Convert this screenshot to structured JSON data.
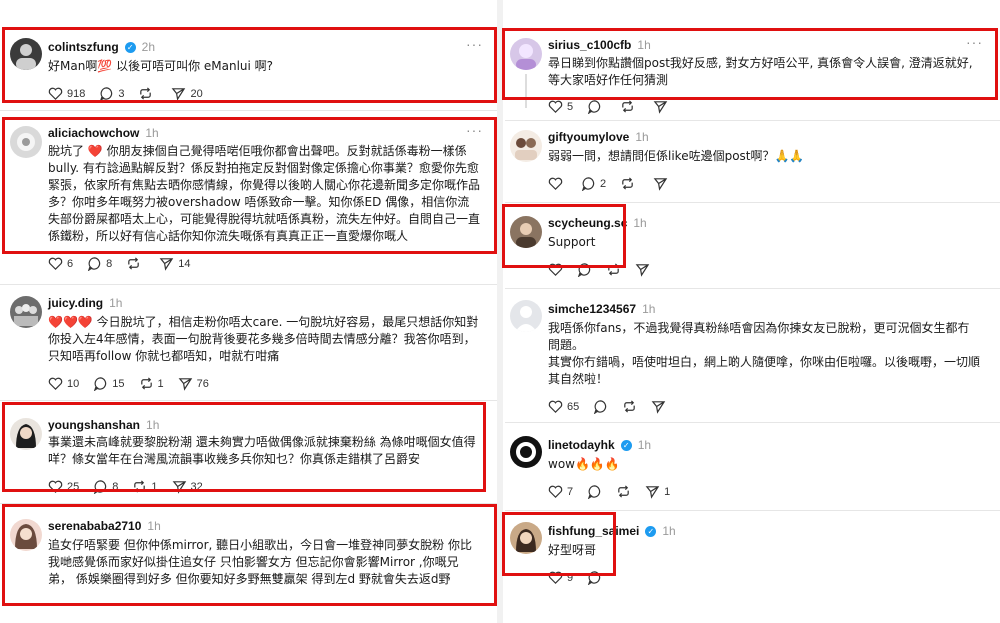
{
  "left": [
    {
      "username": "colintszfung",
      "verified": true,
      "time": "2h",
      "text": "好Man啊💯 以後可唔可叫你 eManlui 啊?",
      "likes": "918",
      "comments": "3",
      "reposts": "",
      "shares": "20"
    },
    {
      "username": "aliciachowchow",
      "verified": false,
      "time": "1h",
      "text": "脫坑了 ❤️ 你朋友揀個自己覺得唔啱佢哦你都會出聲吧。反對就話係毒粉一樣係bully. 有冇諗過點解反對？係反對拍拖定反對個對像定係擔心你事業？愈愛你先愈緊張，依家所有焦點去晒你感情線，你覺得以後啲人關心你花邊新聞多定你嘅作品多？你咁多年嘅努力被overshadow 唔係致命一擊。知你係ED 偶像，相信你流失部份爵屎都唔太上心，可能覺得脫得坑就唔係真粉，流失左仲好。自問自己一直係鐵粉，所以好有信心話你知你流失嘅係有真真正正一直愛爆你嘅人",
      "likes": "6",
      "comments": "8",
      "reposts": "",
      "shares": "14"
    },
    {
      "username": "juicy.ding",
      "verified": false,
      "time": "1h",
      "text": "❤️❤️❤️ 今日脫坑了，相信走粉你唔太care. 一句脫坑好容易，最尾只想話你知對你投入左4年感情，表面一句脫背後要花多幾多倍時間去情感分離？我答你唔到，只知唔再follow 你就乜都唔知，咁就冇咁痛",
      "likes": "10",
      "comments": "15",
      "reposts": "1",
      "shares": "76"
    },
    {
      "username": "youngshanshan",
      "verified": false,
      "time": "1h",
      "text": "事業還未高峰就要黎脫粉潮 還未夠實力唔做偶像派就揀棄粉絲 為條咁嘅個女值得咩？條女當年在台灣風流韻事收幾多兵你知乜？你真係走錯棋了呂爵安",
      "likes": "25",
      "comments": "8",
      "reposts": "1",
      "shares": "32"
    },
    {
      "username": "serenababa2710",
      "verified": false,
      "time": "1h",
      "text": "追女仔唔緊要 但你仲係mirror, 聽日小組歌出，今日會一堆登神同夢女脫粉 你比我哋感覺係而家好似掛住追女仔 只怕影響女方 但忘記你會影響Mirror ,你嘅兄弟， 係娛樂圈得到好多 但你要知好多野無雙贏架 得到左d 野就會失去返d野",
      "likes": "",
      "comments": "",
      "reposts": "",
      "shares": ""
    }
  ],
  "right": [
    {
      "username": "sirius_c100cfb",
      "verified": false,
      "time": "1h",
      "text": "尋日睇到你點讚個post我好反感, 對女方好唔公平, 真係會令人誤會, 澄清返就好, 等大家唔好作任何猜測",
      "likes": "5",
      "comments": "",
      "reposts": "",
      "shares": ""
    },
    {
      "username": "giftyoumylove",
      "verified": false,
      "time": "1h",
      "text": "弱弱一問，想請問佢係like咗邊個post啊？🙏🙏",
      "likes": "",
      "comments": "2",
      "reposts": "",
      "shares": ""
    },
    {
      "username": "scycheung.sc",
      "verified": false,
      "time": "1h",
      "text": "Support",
      "likes": "",
      "comments": "",
      "reposts": "",
      "shares": ""
    },
    {
      "username": "simche1234567",
      "verified": false,
      "time": "1h",
      "text": "我唔係你fans，不過我覺得真粉絲唔會因為你揀女友已脫粉，更可況個女生都冇問題。\n其實你冇錯喎，唔使咁坦白，網上啲人隨便嗱，你咪由佢啦囉。以後嘅嘢，一切順其自然啦！",
      "likes": "65",
      "comments": "",
      "reposts": "",
      "shares": ""
    },
    {
      "username": "linetodayhk",
      "verified": true,
      "time": "1h",
      "text": "wow🔥🔥🔥",
      "likes": "7",
      "comments": "",
      "reposts": "",
      "shares": "1"
    },
    {
      "username": "fishfung_saimei",
      "verified": true,
      "time": "1h",
      "text": "好型呀哥",
      "likes": "9",
      "comments": "",
      "reposts": "",
      "shares": ""
    }
  ],
  "colors": {
    "highlight": "#e01010",
    "verified": "#1d9bf0"
  }
}
